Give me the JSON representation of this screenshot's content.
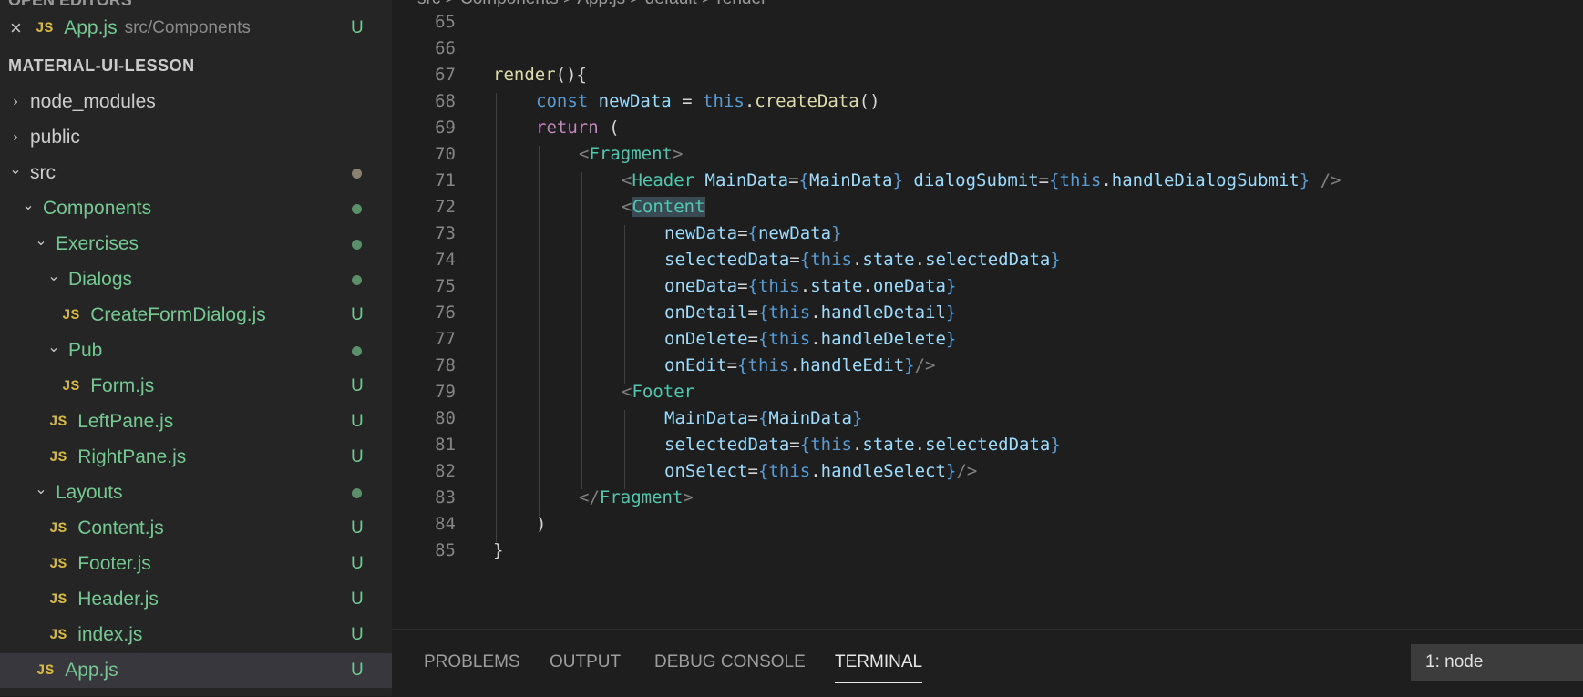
{
  "sidebar": {
    "top_cut_title": "OPEN EDITORS",
    "open_editor": {
      "name": "App.js",
      "path": "src/Components",
      "status": "U"
    },
    "section_title": "MATERIAL-UI-LESSON",
    "tree": [
      {
        "label": "node_modules",
        "kind": "folder",
        "expanded": false,
        "depth": 0
      },
      {
        "label": "public",
        "kind": "folder",
        "expanded": false,
        "depth": 0
      },
      {
        "label": "src",
        "kind": "folder",
        "expanded": true,
        "depth": 0,
        "dot": "grey"
      },
      {
        "label": "Components",
        "kind": "folder",
        "expanded": true,
        "depth": 1,
        "dot": "green"
      },
      {
        "label": "Exercises",
        "kind": "folder",
        "expanded": true,
        "depth": 2,
        "dot": "green"
      },
      {
        "label": "Dialogs",
        "kind": "folder",
        "expanded": true,
        "depth": 3,
        "dot": "green"
      },
      {
        "label": "CreateFormDialog.js",
        "kind": "file",
        "depth": 4,
        "status": "U"
      },
      {
        "label": "Pub",
        "kind": "folder",
        "expanded": true,
        "depth": 3,
        "dot": "green"
      },
      {
        "label": "Form.js",
        "kind": "file",
        "depth": 4,
        "status": "U"
      },
      {
        "label": "LeftPane.js",
        "kind": "file",
        "depth": 3,
        "status": "U"
      },
      {
        "label": "RightPane.js",
        "kind": "file",
        "depth": 3,
        "status": "U"
      },
      {
        "label": "Layouts",
        "kind": "folder",
        "expanded": true,
        "depth": 2,
        "dot": "green"
      },
      {
        "label": "Content.js",
        "kind": "file",
        "depth": 3,
        "status": "U"
      },
      {
        "label": "Footer.js",
        "kind": "file",
        "depth": 3,
        "status": "U"
      },
      {
        "label": "Header.js",
        "kind": "file",
        "depth": 3,
        "status": "U"
      },
      {
        "label": "index.js",
        "kind": "file",
        "depth": 3,
        "status": "U"
      },
      {
        "label": "App.js",
        "kind": "file",
        "depth": 2,
        "status": "U",
        "selected": true
      }
    ]
  },
  "editor": {
    "breadcrumb": "src > Components > App.js > default > render",
    "lines": [
      {
        "n": "65",
        "indent": 0,
        "tokens": []
      },
      {
        "n": "66",
        "indent": 0,
        "tokens": []
      },
      {
        "n": "67",
        "indent": 1,
        "tokens": [
          [
            "fn",
            "render"
          ],
          [
            "p",
            "(){"
          ]
        ]
      },
      {
        "n": "68",
        "indent": 2,
        "tokens": [
          [
            "kw",
            "const "
          ],
          [
            "var",
            "newData"
          ],
          [
            "p",
            " = "
          ],
          [
            "kw",
            "this"
          ],
          [
            "p",
            "."
          ],
          [
            "fn",
            "createData"
          ],
          [
            "p",
            "()"
          ]
        ]
      },
      {
        "n": "69",
        "indent": 2,
        "tokens": [
          [
            "kw2",
            "return"
          ],
          [
            "p",
            " ("
          ]
        ]
      },
      {
        "n": "70",
        "indent": 3,
        "tokens": [
          [
            "br",
            "<"
          ],
          [
            "tag",
            "Fragment"
          ],
          [
            "br",
            ">"
          ]
        ]
      },
      {
        "n": "71",
        "indent": 4,
        "tokens": [
          [
            "br",
            "<"
          ],
          [
            "tag",
            "Header"
          ],
          [
            "p",
            " "
          ],
          [
            "var",
            "MainData"
          ],
          [
            "p",
            "="
          ],
          [
            "kw",
            "{"
          ],
          [
            "var",
            "MainData"
          ],
          [
            "kw",
            "}"
          ],
          [
            "p",
            " "
          ],
          [
            "var",
            "dialogSubmit"
          ],
          [
            "p",
            "="
          ],
          [
            "kw",
            "{"
          ],
          [
            "kw",
            "this"
          ],
          [
            "p",
            "."
          ],
          [
            "var",
            "handleDialogSubmit"
          ],
          [
            "kw",
            "}"
          ],
          [
            "p",
            " "
          ],
          [
            "br",
            "/>"
          ]
        ]
      },
      {
        "n": "72",
        "indent": 4,
        "tokens": [
          [
            "br",
            "<"
          ],
          [
            "taghl",
            "Content"
          ]
        ]
      },
      {
        "n": "73",
        "indent": 5,
        "tokens": [
          [
            "var",
            "newData"
          ],
          [
            "p",
            "="
          ],
          [
            "kw",
            "{"
          ],
          [
            "var",
            "newData"
          ],
          [
            "kw",
            "}"
          ]
        ]
      },
      {
        "n": "74",
        "indent": 5,
        "tokens": [
          [
            "var",
            "selectedData"
          ],
          [
            "p",
            "="
          ],
          [
            "kw",
            "{"
          ],
          [
            "kw",
            "this"
          ],
          [
            "p",
            "."
          ],
          [
            "var",
            "state"
          ],
          [
            "p",
            "."
          ],
          [
            "var",
            "selectedData"
          ],
          [
            "kw",
            "}"
          ]
        ]
      },
      {
        "n": "75",
        "indent": 5,
        "tokens": [
          [
            "var",
            "oneData"
          ],
          [
            "p",
            "="
          ],
          [
            "kw",
            "{"
          ],
          [
            "kw",
            "this"
          ],
          [
            "p",
            "."
          ],
          [
            "var",
            "state"
          ],
          [
            "p",
            "."
          ],
          [
            "var",
            "oneData"
          ],
          [
            "kw",
            "}"
          ]
        ]
      },
      {
        "n": "76",
        "indent": 5,
        "tokens": [
          [
            "var",
            "onDetail"
          ],
          [
            "p",
            "="
          ],
          [
            "kw",
            "{"
          ],
          [
            "kw",
            "this"
          ],
          [
            "p",
            "."
          ],
          [
            "var",
            "handleDetail"
          ],
          [
            "kw",
            "}"
          ]
        ]
      },
      {
        "n": "77",
        "indent": 5,
        "tokens": [
          [
            "var",
            "onDelete"
          ],
          [
            "p",
            "="
          ],
          [
            "kw",
            "{"
          ],
          [
            "kw",
            "this"
          ],
          [
            "p",
            "."
          ],
          [
            "var",
            "handleDelete"
          ],
          [
            "kw",
            "}"
          ]
        ]
      },
      {
        "n": "78",
        "indent": 5,
        "tokens": [
          [
            "var",
            "onEdit"
          ],
          [
            "p",
            "="
          ],
          [
            "kw",
            "{"
          ],
          [
            "kw",
            "this"
          ],
          [
            "p",
            "."
          ],
          [
            "var",
            "handleEdit"
          ],
          [
            "kw",
            "}"
          ],
          [
            "br",
            "/>"
          ]
        ]
      },
      {
        "n": "79",
        "indent": 4,
        "tokens": [
          [
            "br",
            "<"
          ],
          [
            "tag",
            "Footer"
          ]
        ]
      },
      {
        "n": "80",
        "indent": 5,
        "tokens": [
          [
            "var",
            "MainData"
          ],
          [
            "p",
            "="
          ],
          [
            "kw",
            "{"
          ],
          [
            "var",
            "MainData"
          ],
          [
            "kw",
            "}"
          ]
        ]
      },
      {
        "n": "81",
        "indent": 5,
        "tokens": [
          [
            "var",
            "selectedData"
          ],
          [
            "p",
            "="
          ],
          [
            "kw",
            "{"
          ],
          [
            "kw",
            "this"
          ],
          [
            "p",
            "."
          ],
          [
            "var",
            "state"
          ],
          [
            "p",
            "."
          ],
          [
            "var",
            "selectedData"
          ],
          [
            "kw",
            "}"
          ]
        ]
      },
      {
        "n": "82",
        "indent": 5,
        "tokens": [
          [
            "var",
            "onSelect"
          ],
          [
            "p",
            "="
          ],
          [
            "kw",
            "{"
          ],
          [
            "kw",
            "this"
          ],
          [
            "p",
            "."
          ],
          [
            "var",
            "handleSelect"
          ],
          [
            "kw",
            "}"
          ],
          [
            "br",
            "/>"
          ]
        ]
      },
      {
        "n": "83",
        "indent": 3,
        "tokens": [
          [
            "br",
            "</"
          ],
          [
            "tag",
            "Fragment"
          ],
          [
            "br",
            ">"
          ]
        ]
      },
      {
        "n": "84",
        "indent": 2,
        "tokens": [
          [
            "p",
            ")"
          ]
        ]
      },
      {
        "n": "85",
        "indent": 1,
        "tokens": [
          [
            "p",
            "}"
          ]
        ]
      }
    ]
  },
  "panel": {
    "tabs": [
      {
        "label": "PROBLEMS",
        "active": false
      },
      {
        "label": "OUTPUT",
        "active": false
      },
      {
        "label": "DEBUG CONSOLE",
        "active": false
      },
      {
        "label": "TERMINAL",
        "active": true
      }
    ],
    "terminal_select": "1: node"
  }
}
